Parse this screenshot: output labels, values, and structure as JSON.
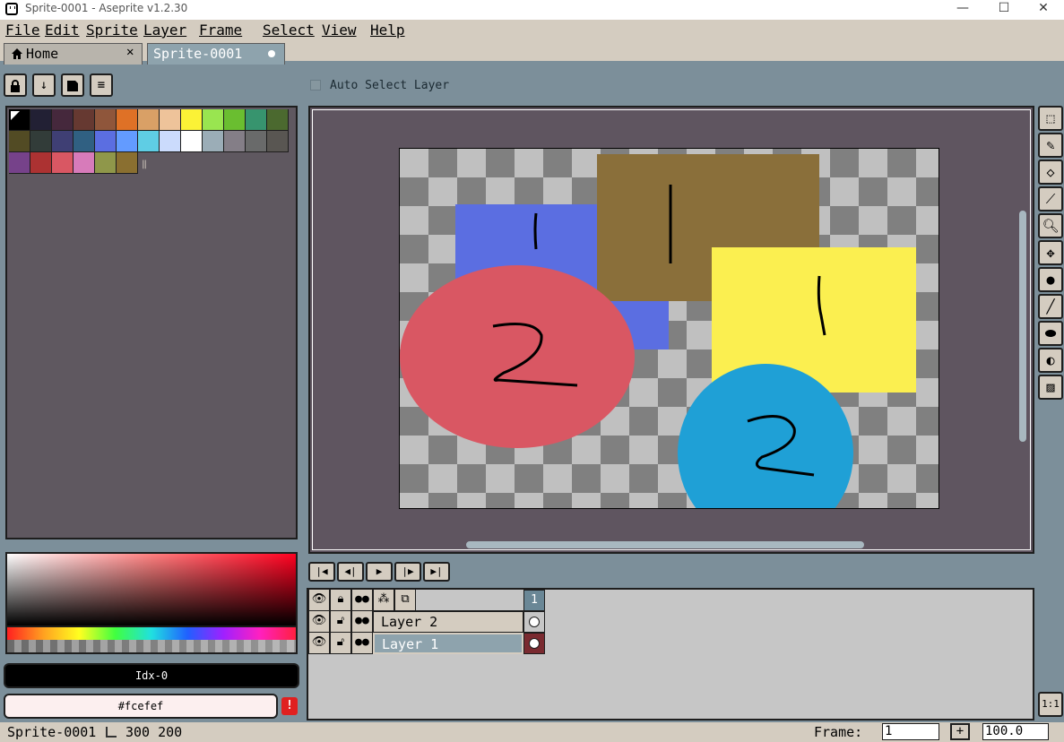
{
  "window": {
    "title": "Sprite-0001 - Aseprite v1.2.30"
  },
  "menu": [
    "File",
    "Edit",
    "Sprite",
    "Layer",
    "Frame",
    "Select",
    "View",
    "Help"
  ],
  "tabs": {
    "home": "Home",
    "sprite": "Sprite-0001"
  },
  "toolbar": {
    "auto_select_label": "Auto Select Layer"
  },
  "palette": {
    "colors": [
      "#000000",
      "#222034",
      "#45283c",
      "#663931",
      "#8f563b",
      "#df7126",
      "#d9a066",
      "#eec39a",
      "#fbf236",
      "#99e550",
      "#6abe30",
      "#37946e",
      "#4b692f",
      "#524b24",
      "#323c39",
      "#3f3f74",
      "#306082",
      "#5b6ee1",
      "#639bff",
      "#5fcde4",
      "#cbdbfc",
      "#ffffff",
      "#9badb7",
      "#847e87",
      "#696a6a",
      "#595652",
      "#76428a",
      "#ac3232",
      "#d95763",
      "#d77bba",
      "#8f974a",
      "#8a6f30"
    ]
  },
  "color_bar": {
    "index_label": "Idx-0",
    "hex_label": "#fcefef",
    "warning": "!"
  },
  "canvas": {
    "shapes_text": {
      "blue": "1",
      "brown": "1",
      "yellow": "1",
      "red": "2",
      "cyan": "2"
    },
    "colors": {
      "blue": "#5b6ee1",
      "brown": "#8a6f3a",
      "yellow": "#fbef50",
      "red": "#d95763",
      "cyan": "#1fa0d6"
    }
  },
  "timeline": {
    "frame_header": "1",
    "layers": [
      {
        "name": "Layer 2",
        "selected": false
      },
      {
        "name": "Layer 1",
        "selected": true
      }
    ]
  },
  "status": {
    "sprite_name": "Sprite-0001",
    "size": "300 200",
    "frame_label": "Frame:",
    "frame_value": "1",
    "zoom_value": "100.0"
  }
}
